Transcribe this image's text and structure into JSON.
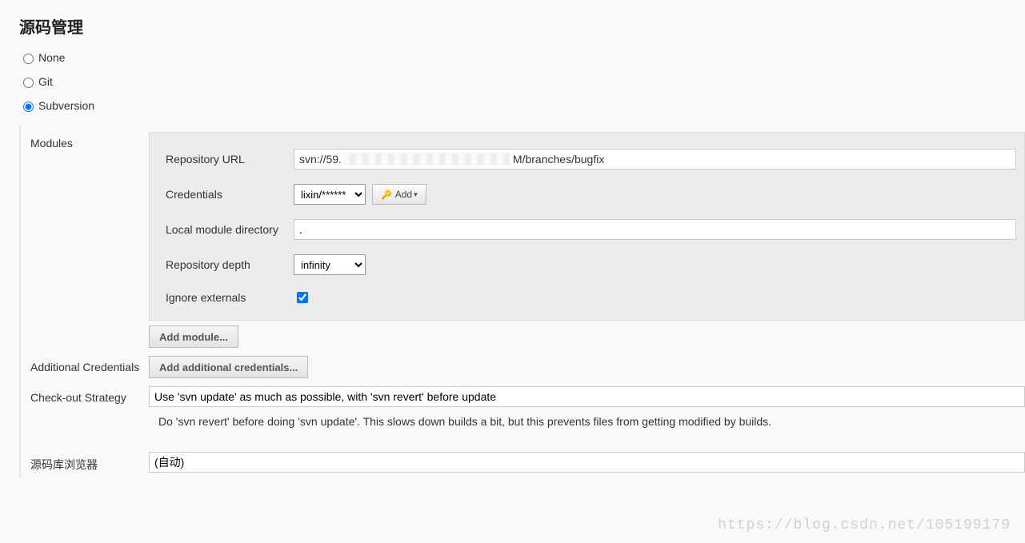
{
  "section_title": "源码管理",
  "scm_options": {
    "none": "None",
    "git": "Git",
    "subversion": "Subversion"
  },
  "modules": {
    "label": "Modules",
    "repo_url_label": "Repository URL",
    "repo_url_prefix": "svn://59.",
    "repo_url_suffix": "M/branches/bugfix",
    "credentials_label": "Credentials",
    "credentials_value": "lixin/******",
    "add_btn": "Add",
    "local_dir_label": "Local module directory",
    "local_dir_value": ".",
    "depth_label": "Repository depth",
    "depth_value": "infinity",
    "ignore_ext_label": "Ignore externals",
    "add_module_btn": "Add module..."
  },
  "additional_credentials": {
    "label": "Additional Credentials",
    "btn": "Add additional credentials..."
  },
  "checkout_strategy": {
    "label": "Check-out Strategy",
    "value": "Use 'svn update' as much as possible, with 'svn revert' before update",
    "help": "Do 'svn revert' before doing 'svn update'. This slows down builds a bit, but this prevents files from getting modified by builds."
  },
  "repo_browser": {
    "label": "源码库浏览器",
    "value": "(自动)"
  },
  "watermark": "https://blog.csdn.net/105199179"
}
